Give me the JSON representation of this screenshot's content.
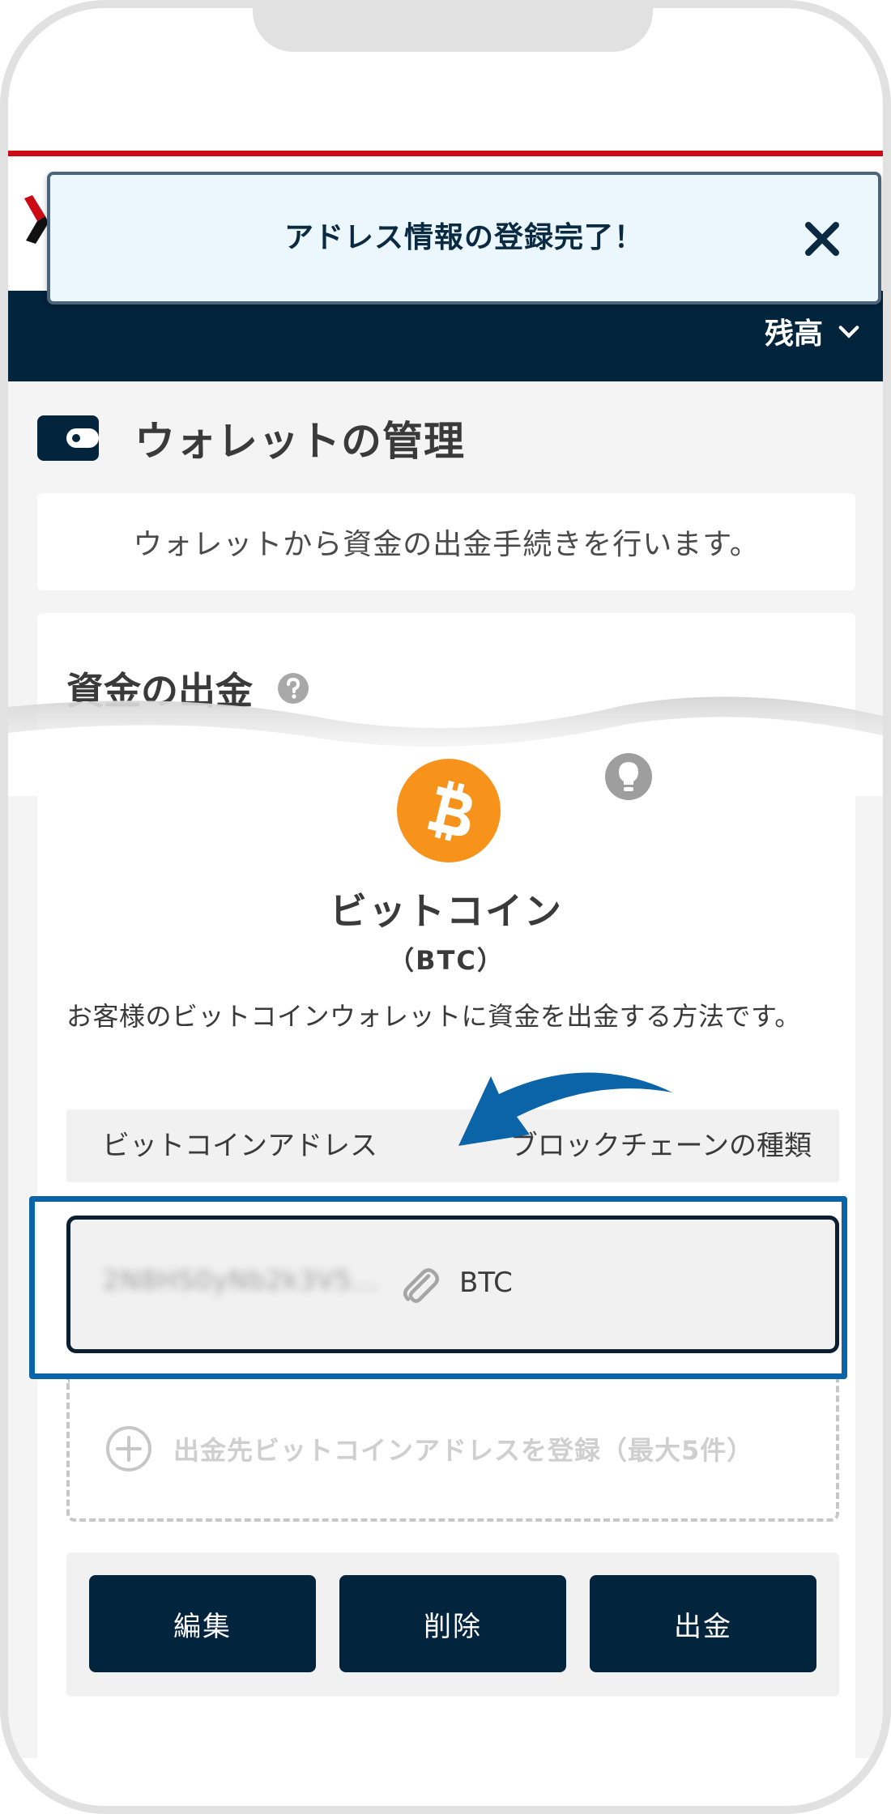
{
  "toast": {
    "message": "アドレス情報の登録完了！"
  },
  "header": {
    "balance_label": "残高"
  },
  "page": {
    "title": "ウォレットの管理",
    "description": "ウォレットから資金の出金手続きを行います。"
  },
  "withdrawal": {
    "section_title": "資金の出金",
    "coin_name": "ビットコイン",
    "coin_code": "（BTC）",
    "method_text": "お客様のビットコインウォレットに資金を出金する方法です。",
    "columns": {
      "address": "ビットコインアドレス",
      "chain": "ブロックチェーンの種類"
    },
    "address_value": "2N8HS0yNb2k3V5...",
    "chain_value": "BTC",
    "register_label": "出金先ビットコインアドレスを登録（最大5件）",
    "buttons": {
      "edit": "編集",
      "delete": "削除",
      "withdraw": "出金"
    }
  },
  "colors": {
    "navy": "#03243d",
    "brand_red": "#cc0a14",
    "highlight_blue": "#0b64a8",
    "bitcoin_orange": "#f7931a"
  }
}
